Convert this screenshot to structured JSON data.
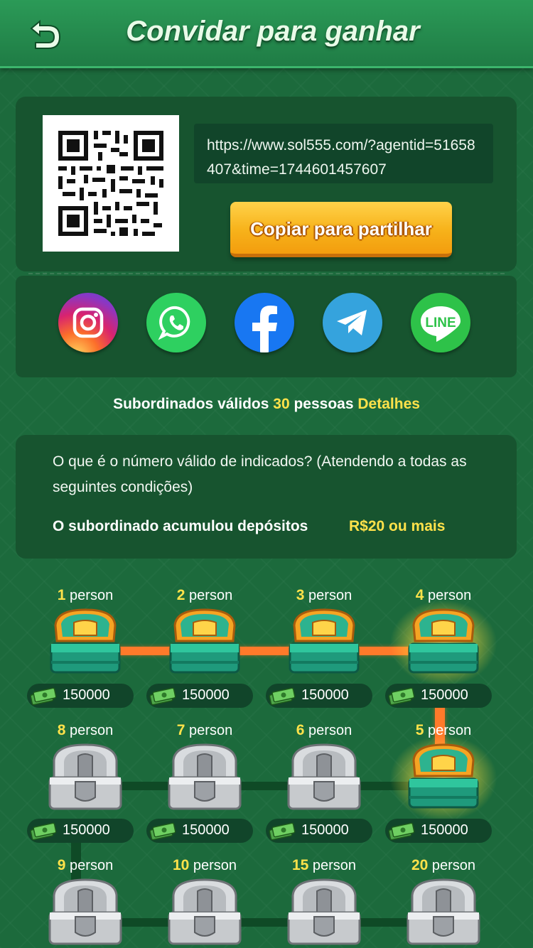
{
  "header": {
    "title": "Convidar para ganhar",
    "back_icon": "back-arrow-icon"
  },
  "invite": {
    "link": "https://www.sol555.com/?agentid=51658407&time=1744601457607",
    "copy_label": "Copiar para partilhar"
  },
  "share": [
    {
      "name": "instagram",
      "icon": "instagram-icon"
    },
    {
      "name": "whatsapp",
      "icon": "whatsapp-icon"
    },
    {
      "name": "facebook",
      "icon": "facebook-icon"
    },
    {
      "name": "telegram",
      "icon": "telegram-icon"
    },
    {
      "name": "line",
      "icon": "line-icon",
      "text": "LINE"
    }
  ],
  "subordinates": {
    "prefix": "Subordinados válidos",
    "count": "30",
    "unit": "pessoas",
    "details": "Detalhes"
  },
  "info": {
    "question": "O que é o número válido de indicados? (Atendendo a todas as seguintes condições)",
    "condition_label": "O subordinado acumulou depósitos",
    "condition_value": "R$20 ou mais"
  },
  "rewards": [
    {
      "count": "1",
      "unit": "person",
      "amount": "150000",
      "state": "open"
    },
    {
      "count": "2",
      "unit": "person",
      "amount": "150000",
      "state": "open"
    },
    {
      "count": "3",
      "unit": "person",
      "amount": "150000",
      "state": "open"
    },
    {
      "count": "4",
      "unit": "person",
      "amount": "150000",
      "state": "claimable"
    },
    {
      "count": "5",
      "unit": "person",
      "amount": "150000",
      "state": "claimable"
    },
    {
      "count": "6",
      "unit": "person",
      "amount": "150000",
      "state": "locked"
    },
    {
      "count": "7",
      "unit": "person",
      "amount": "150000",
      "state": "locked"
    },
    {
      "count": "8",
      "unit": "person",
      "amount": "150000",
      "state": "locked"
    },
    {
      "count": "9",
      "unit": "person",
      "state": "locked"
    },
    {
      "count": "10",
      "unit": "person",
      "state": "locked"
    },
    {
      "count": "15",
      "unit": "person",
      "state": "locked"
    },
    {
      "count": "20",
      "unit": "person",
      "state": "locked"
    }
  ],
  "colors": {
    "accent_yellow": "#ffe24a",
    "button_orange": "#f7b21a",
    "path_orange": "#ff7a2a",
    "background": "#1c6a3c"
  }
}
